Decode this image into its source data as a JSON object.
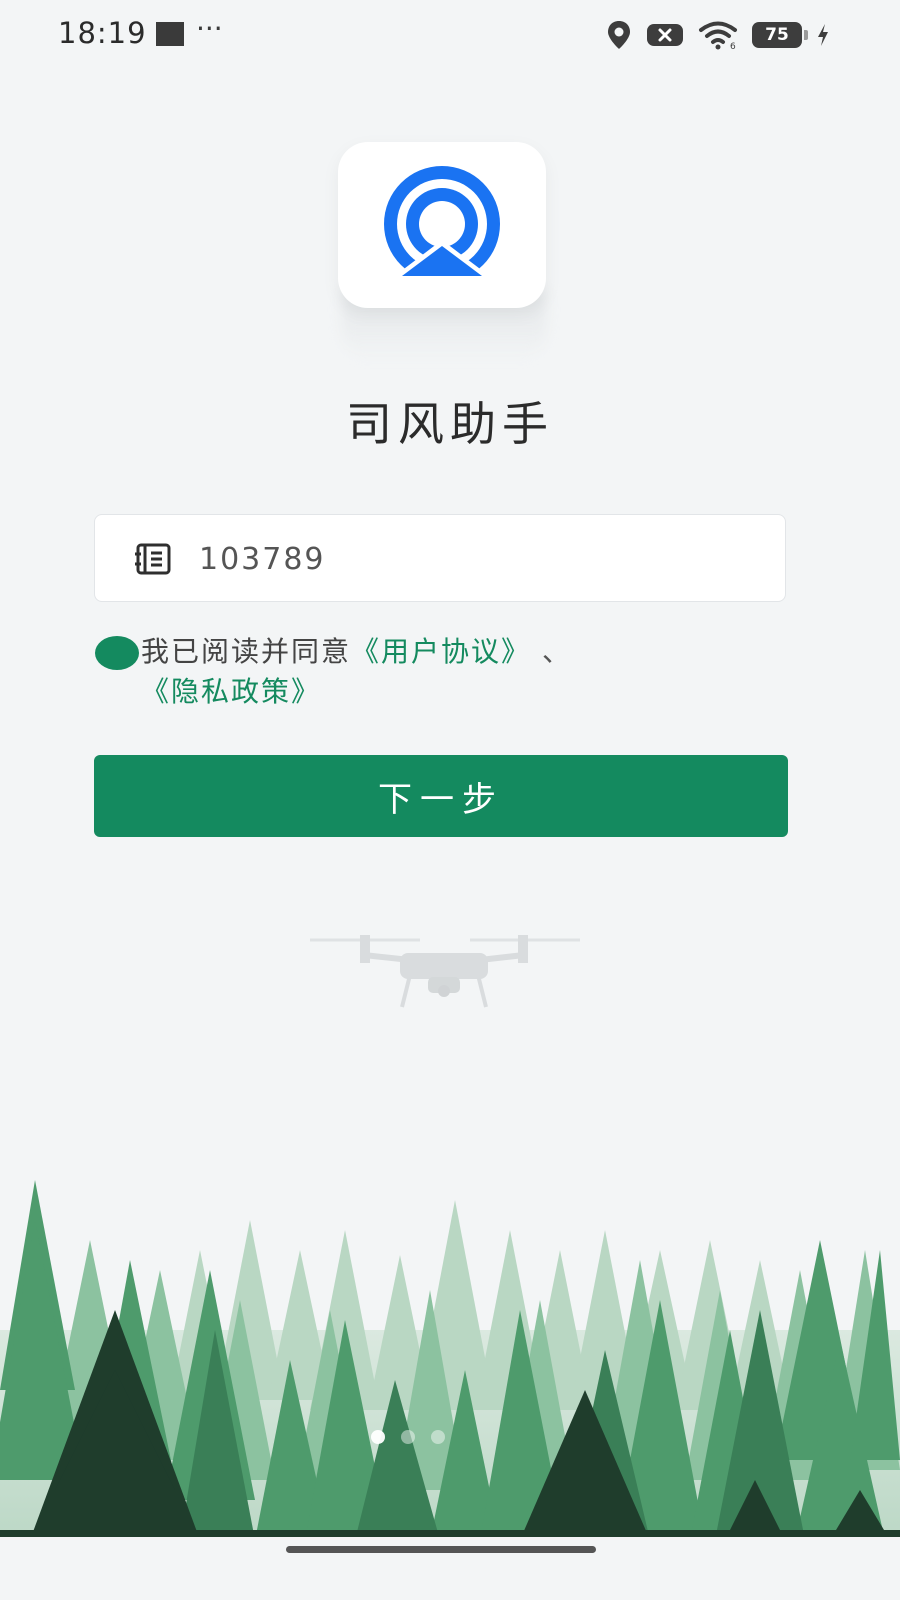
{
  "status_bar": {
    "time": "18:19",
    "dots": "···",
    "battery": "75",
    "icons": [
      "location-icon",
      "notification-x-icon",
      "wifi-icon",
      "battery-icon",
      "charging-icon"
    ]
  },
  "app": {
    "name": "司风助手",
    "logo_icon": "signal-ring-logo"
  },
  "login": {
    "input_value": "103789",
    "input_icon": "list-icon"
  },
  "agreement": {
    "prefix": "我已阅读并同意",
    "user_agreement": "《用户协议》",
    "separator": "、",
    "privacy_policy": "《隐私政策》"
  },
  "actions": {
    "next_label": "下一步"
  },
  "pager": {
    "count": 3,
    "active_index": 0
  },
  "colors": {
    "accent": "#148a5f",
    "logo_blue": "#1a73f2",
    "background": "#f3f5f6"
  }
}
